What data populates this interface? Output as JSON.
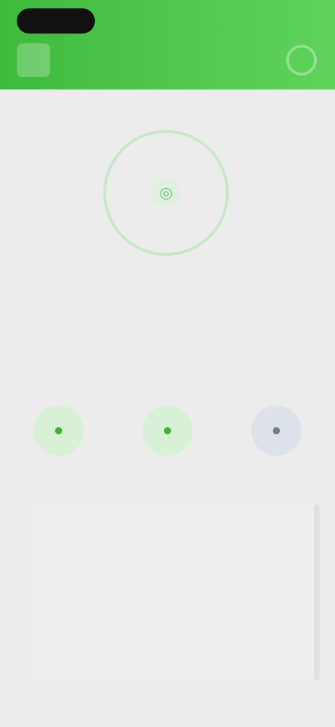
{
  "header": {
    "status_right": "",
    "title": ""
  },
  "ring": {
    "center_icon": "◎"
  },
  "stats": [
    {
      "label": "",
      "value": ""
    },
    {
      "label": "",
      "value": ""
    }
  ],
  "chips_section": {
    "title": ""
  },
  "chips": [
    {
      "icon": "●",
      "name": "green-chip-1"
    },
    {
      "icon": "●",
      "name": "green-chip-2"
    },
    {
      "icon": "●",
      "name": "gray-chip"
    }
  ],
  "card_section": {
    "title": ""
  },
  "card": {
    "tabs": [
      "",
      "",
      "",
      "",
      "",
      ""
    ],
    "list_title": "",
    "grid": [
      "",
      "",
      "",
      "",
      "",
      ""
    ]
  },
  "colors": {
    "header": "#4dc44a",
    "accent": "#3ab53a",
    "background": "#ececec"
  }
}
